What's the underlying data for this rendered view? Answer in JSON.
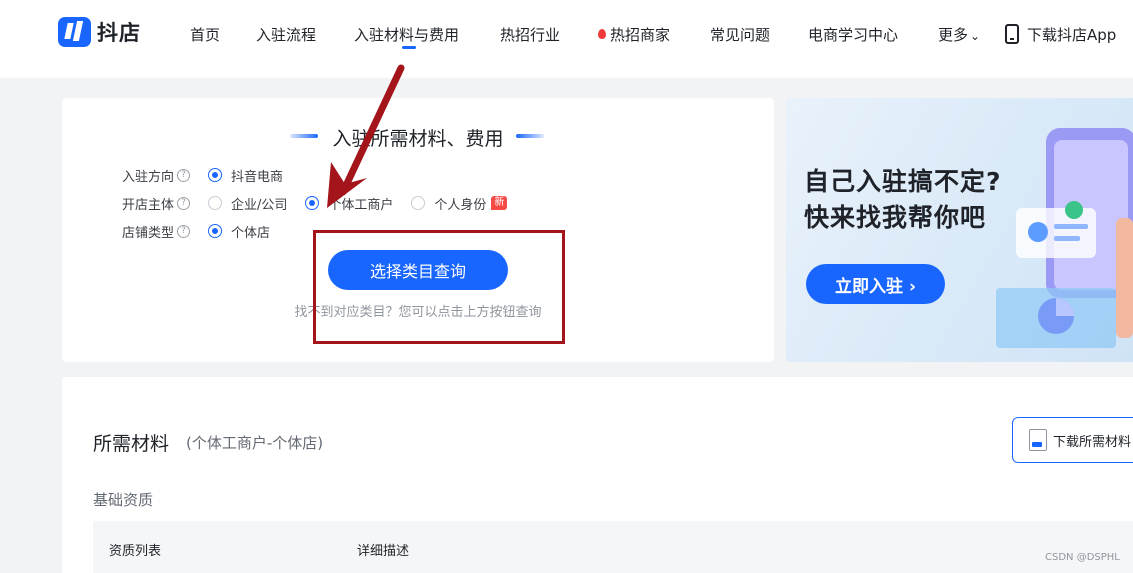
{
  "nav": {
    "brand": "抖店",
    "items": [
      "首页",
      "入驻流程",
      "入驻材料与费用",
      "热招行业",
      "热招商家",
      "常见问题",
      "电商学习中心",
      "更多"
    ],
    "download_app": "下载抖店App",
    "accent": "#1966ff"
  },
  "query": {
    "title": "入驻所需材料、费用",
    "fields": [
      {
        "label": "入驻方向",
        "options": [
          "抖音电商"
        ],
        "selected": "抖音电商"
      },
      {
        "label": "开店主体",
        "options": [
          "企业/公司",
          "个体工商户",
          "个人身份"
        ],
        "selected": "个体工商户",
        "badge": "新"
      },
      {
        "label": "店铺类型",
        "options": [
          "个体店"
        ],
        "selected": "个体店"
      }
    ],
    "button": "选择类目查询",
    "hint": "找不到对应类目？您可以点击上方按钮查询"
  },
  "banner": {
    "line1": "自己入驻搞不定?",
    "line2": "快来找我帮你吧",
    "button": "立即入驻"
  },
  "materials": {
    "title": "所需材料",
    "subtitle": "(个体工商户-个体店)",
    "download": "下载所需材料",
    "section": "基础资质",
    "columns": [
      "资质列表",
      "详细描述"
    ]
  },
  "watermark": "CSDN @DSPHL",
  "annotation_color": "#a3141b"
}
